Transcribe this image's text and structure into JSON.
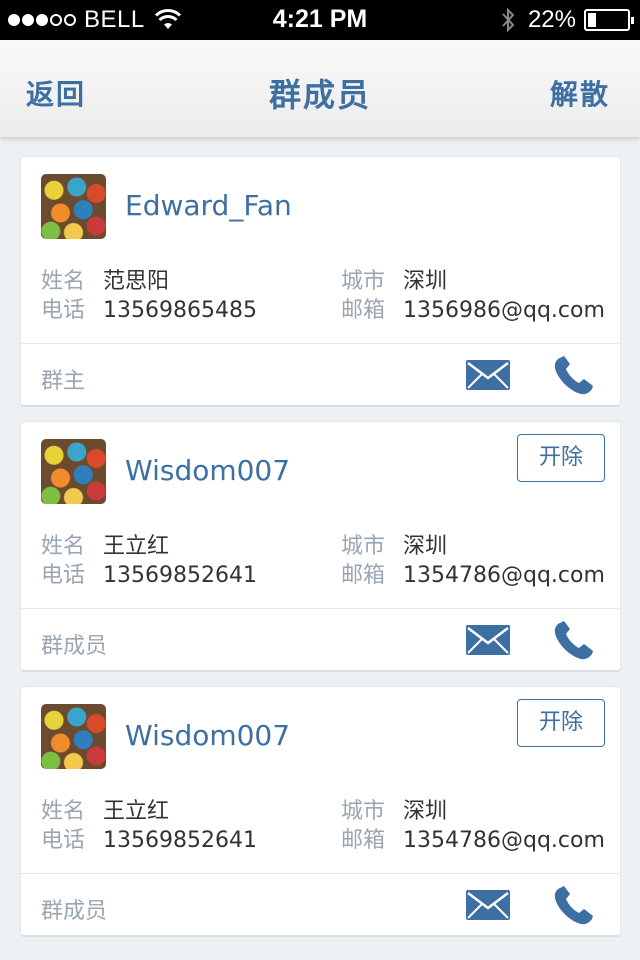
{
  "status_bar": {
    "carrier": "BELL",
    "time": "4:21 PM",
    "battery_text": "22%",
    "battery_level": 0.22,
    "signal_bars_filled": 3,
    "signal_bars_total": 5
  },
  "navbar": {
    "back_label": "返回",
    "title": "群成员",
    "dissolve_label": "解散"
  },
  "labels": {
    "name": "姓名",
    "phone": "电话",
    "city": "城市",
    "email": "邮箱"
  },
  "members": [
    {
      "username": "Edward_Fan",
      "name": "范思阳",
      "phone": "13569865485",
      "city": "深圳",
      "email": "1356986@qq.com",
      "role": "群主",
      "kick_label": ""
    },
    {
      "username": "Wisdom007",
      "name": "王立红",
      "phone": "13569852641",
      "city": "深圳",
      "email": "1354786@qq.com",
      "role": "群成员",
      "kick_label": "开除"
    },
    {
      "username": "Wisdom007",
      "name": "王立红",
      "phone": "13569852641",
      "city": "深圳",
      "email": "1354786@qq.com",
      "role": "群成员",
      "kick_label": "开除"
    }
  ],
  "icons": {
    "mail": "mail-icon",
    "phone": "phone-icon",
    "wifi": "wifi-icon",
    "bluetooth": "bluetooth-icon"
  },
  "colors": {
    "accent": "#3d6fa3",
    "label_gray": "#9aa6b2",
    "background": "#eef1f4"
  }
}
